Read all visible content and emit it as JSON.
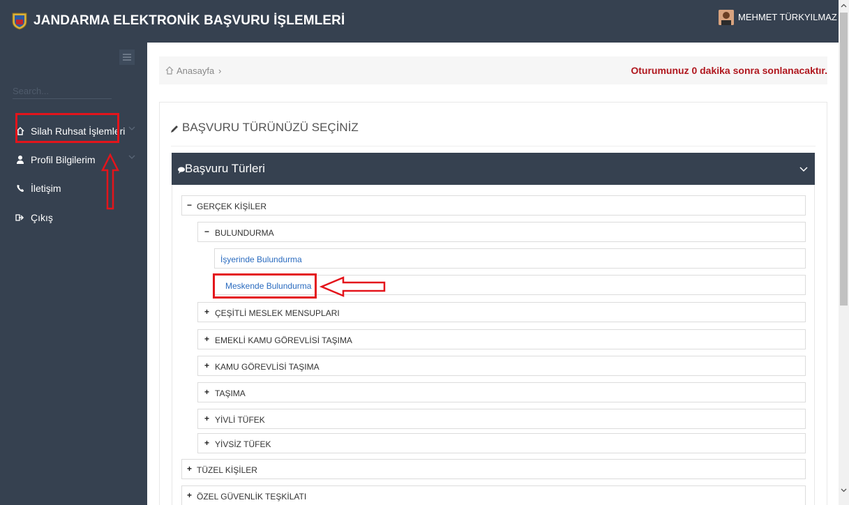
{
  "header": {
    "app_title": "JANDARMA ELEKTRONİK BAŞVURU İŞLEMLERİ",
    "user_name": "MEHMET TÜRKYILMAZ"
  },
  "sidebar": {
    "search_placeholder": "Search...",
    "items": [
      {
        "label": "Silah Ruhsat İşlemleri",
        "icon": "home-icon"
      },
      {
        "label": "Profil Bilgilerim",
        "icon": "user-icon"
      },
      {
        "label": "İletişim",
        "icon": "phone-icon"
      },
      {
        "label": "Çıkış",
        "icon": "sign-out-icon"
      }
    ]
  },
  "breadcrumb": {
    "home": "Anasayfa",
    "separator": "›"
  },
  "session_warning": "Oturumunuz 0 dakika sonra sonlanacaktır.",
  "page_title": "BAŞVURU TÜRÜNÜZÜ SEÇİNİZ",
  "panel": {
    "title": "Başvuru Türleri"
  },
  "tree": {
    "gercek": "GERÇEK KİŞİLER",
    "bulundurma": "BULUNDURMA",
    "isyerinde": "İşyerinde Bulundurma",
    "meskende": "Meskende Bulundurma",
    "cesitli": "ÇEŞİTLİ MESLEK MENSUPLARI",
    "emekli": "EMEKLİ KAMU GÖREVLİSİ TAŞIMA",
    "kamu": "KAMU GÖREVLİSİ TAŞIMA",
    "tasima": "TAŞIMA",
    "yivli": "YİVLİ TÜFEK",
    "yivsiz": "YİVSİZ TÜFEK",
    "tuzel": "TÜZEL KİŞİLER",
    "ozel": "ÖZEL GÜVENLİK TEŞKİLATI",
    "sign_minus": "−",
    "sign_plus": "+"
  },
  "colors": {
    "sidebar_bg": "#364150",
    "warning_red": "#b0171e",
    "link_blue": "#2a6bbf",
    "annotation_red": "#e4141b"
  }
}
